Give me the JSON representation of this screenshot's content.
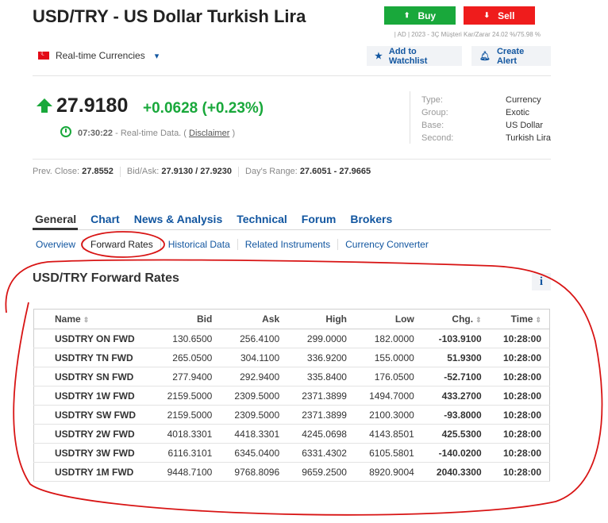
{
  "header": {
    "title": "USD/TRY - US Dollar Turkish Lira",
    "buy_label": "Buy",
    "sell_label": "Sell",
    "ad_note": "| AD | 2023 - 3Ç Müşteri Kar/Zarar 24.02 %/75.98 %",
    "realtime_label": "Real-time Currencies",
    "watchlist_label": "Add to Watchlist",
    "alert_label": "Create Alert"
  },
  "quote": {
    "price": "27.9180",
    "change": "+0.0628",
    "change_pct": "(+0.23%)",
    "time": "07:30:22",
    "time_suffix": "- Real-time Data. (",
    "disclaimer": "Disclaimer",
    "time_close": ")"
  },
  "info": [
    {
      "k": "Type:",
      "v": "Currency"
    },
    {
      "k": "Group:",
      "v": "Exotic"
    },
    {
      "k": "Base:",
      "v": "US Dollar"
    },
    {
      "k": "Second:",
      "v": "Turkish Lira"
    }
  ],
  "stats": {
    "prev_close_label": "Prev. Close:",
    "prev_close": "27.8552",
    "bidask_label": "Bid/Ask:",
    "bidask": "27.9130 / 27.9230",
    "range_label": "Day's Range:",
    "range": "27.6051 - 27.9665"
  },
  "tabs": [
    "General",
    "Chart",
    "News & Analysis",
    "Technical",
    "Forum",
    "Brokers"
  ],
  "subtabs": [
    "Overview",
    "Forward Rates",
    "Historical Data",
    "Related Instruments",
    "Currency Converter"
  ],
  "forward": {
    "title": "USD/TRY Forward Rates",
    "info_icon": "i",
    "sort_glyph": "⇕",
    "columns": [
      "Name",
      "Bid",
      "Ask",
      "High",
      "Low",
      "Chg.",
      "Time"
    ],
    "rows": [
      {
        "name": "USDTRY ON FWD",
        "bid": "130.6500",
        "ask": "256.4100",
        "high": "299.0000",
        "low": "182.0000",
        "chg": "-103.9100",
        "time": "10:28:00"
      },
      {
        "name": "USDTRY TN FWD",
        "bid": "265.0500",
        "ask": "304.1100",
        "high": "336.9200",
        "low": "155.0000",
        "chg": "51.9300",
        "time": "10:28:00"
      },
      {
        "name": "USDTRY SN FWD",
        "bid": "277.9400",
        "ask": "292.9400",
        "high": "335.8400",
        "low": "176.0500",
        "chg": "-52.7100",
        "time": "10:28:00"
      },
      {
        "name": "USDTRY 1W FWD",
        "bid": "2159.5000",
        "ask": "2309.5000",
        "high": "2371.3899",
        "low": "1494.7000",
        "chg": "433.2700",
        "time": "10:28:00"
      },
      {
        "name": "USDTRY SW FWD",
        "bid": "2159.5000",
        "ask": "2309.5000",
        "high": "2371.3899",
        "low": "2100.3000",
        "chg": "-93.8000",
        "time": "10:28:00"
      },
      {
        "name": "USDTRY 2W FWD",
        "bid": "4018.3301",
        "ask": "4418.3301",
        "high": "4245.0698",
        "low": "4143.8501",
        "chg": "425.5300",
        "time": "10:28:00"
      },
      {
        "name": "USDTRY 3W FWD",
        "bid": "6116.3101",
        "ask": "6345.0400",
        "high": "6331.4302",
        "low": "6105.5801",
        "chg": "-140.0200",
        "time": "10:28:00"
      },
      {
        "name": "USDTRY 1M FWD",
        "bid": "9448.7100",
        "ask": "9768.8096",
        "high": "9659.2500",
        "low": "8920.9004",
        "chg": "2040.3300",
        "time": "10:28:00"
      }
    ]
  },
  "colors": {
    "up": "#19a83b",
    "down": "#e8111b",
    "link": "#1256a0",
    "annotation": "#d81414"
  }
}
